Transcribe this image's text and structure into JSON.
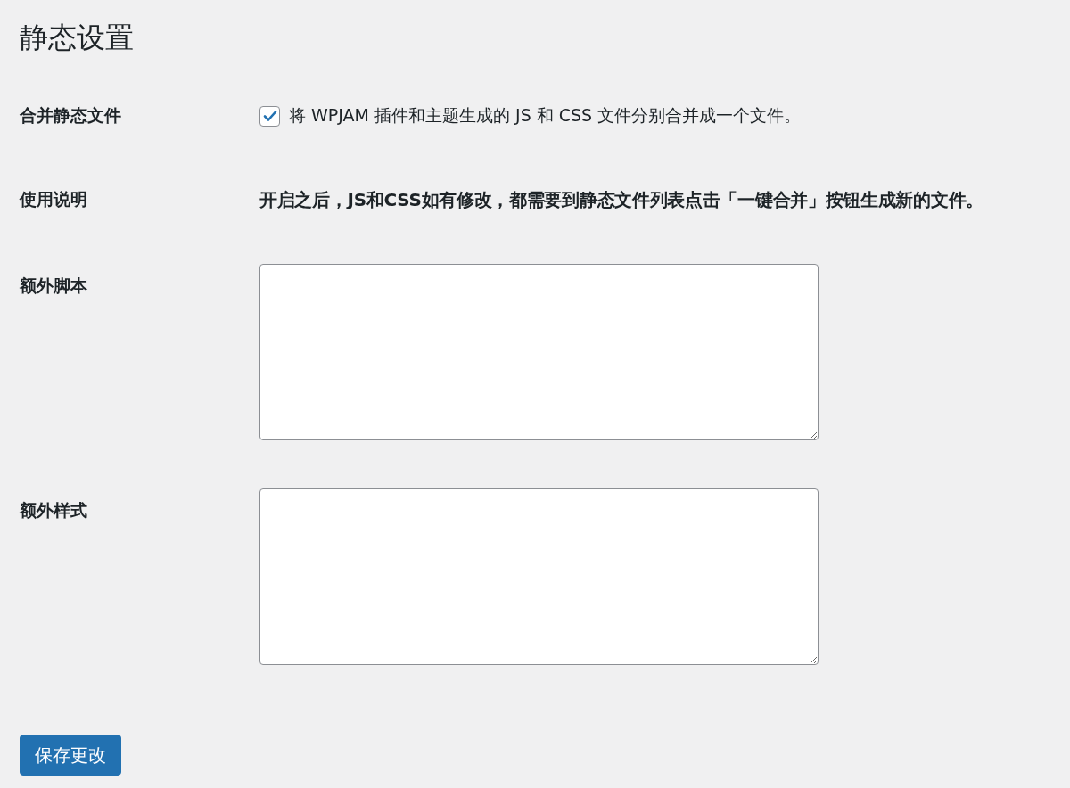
{
  "title": "静态设置",
  "fields": [
    {
      "kind": "checkbox",
      "label": "合并静态文件",
      "checked": true,
      "text": "将 WPJAM 插件和主题生成的 JS 和 CSS 文件分别合并成一个文件。"
    },
    {
      "kind": "note",
      "label": "使用说明",
      "text": "开启之后，JS和CSS如有修改，都需要到静态文件列表点击「一键合并」按钮生成新的文件。"
    },
    {
      "kind": "textarea",
      "label": "额外脚本"
    },
    {
      "kind": "textarea",
      "label": "额外样式"
    }
  ],
  "button": "保存更改"
}
